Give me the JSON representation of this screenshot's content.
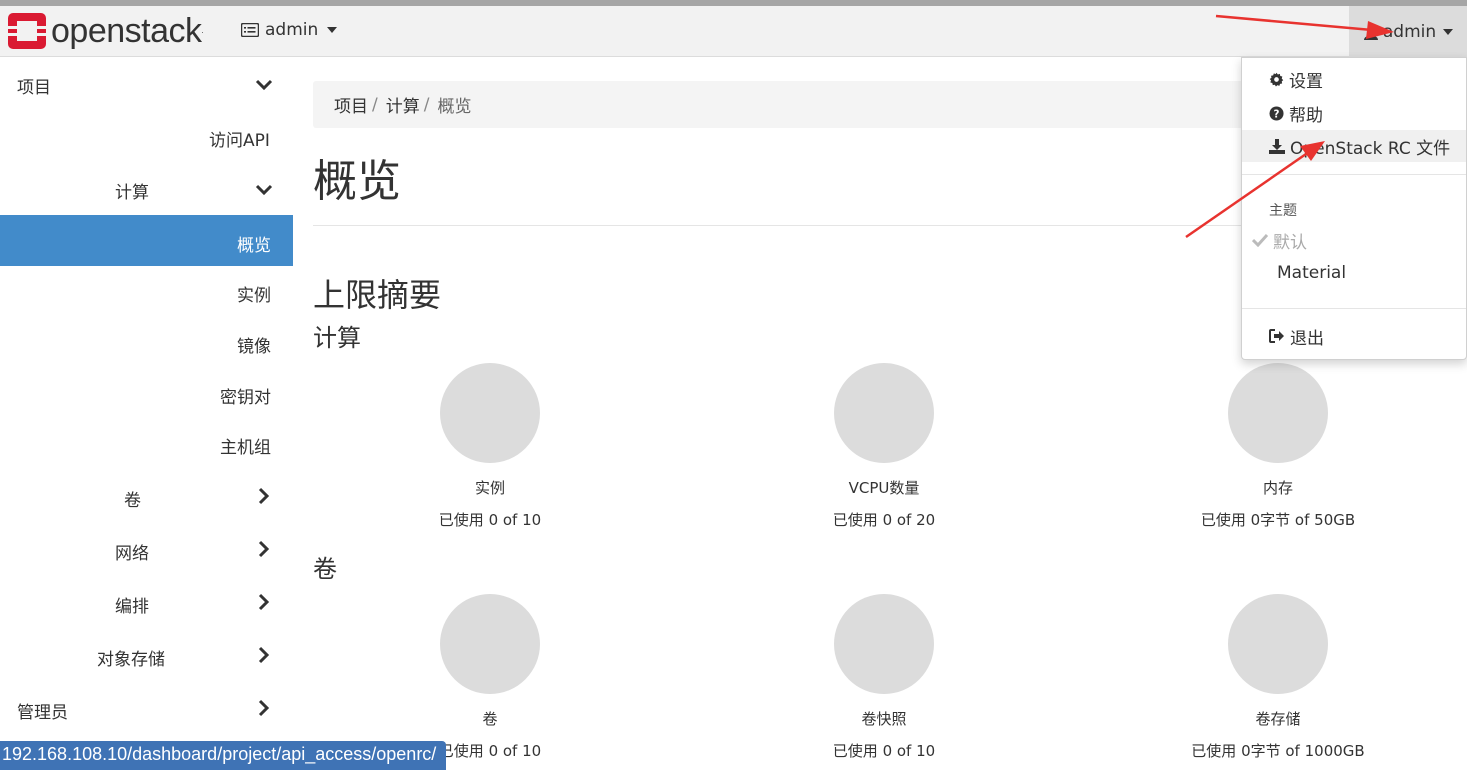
{
  "brand": {
    "name": "openstack",
    "tm": "."
  },
  "navbar": {
    "project_label": "admin",
    "user_label": "admin"
  },
  "sidebar": {
    "project": "项目",
    "api_access": "访问API",
    "compute": "计算",
    "overview": "概览",
    "instances": "实例",
    "images": "镜像",
    "keypairs": "密钥对",
    "host_groups": "主机组",
    "volumes": "卷",
    "network": "网络",
    "orchestration": "编排",
    "object_store": "对象存储",
    "admin": "管理员"
  },
  "breadcrumb": {
    "items": [
      "项目",
      "计算",
      "概览"
    ],
    "sep": "/"
  },
  "page": {
    "title": "概览",
    "limit_summary": "上限摘要",
    "compute_heading": "计算",
    "volume_heading": "卷"
  },
  "compute_limits": [
    {
      "label": "实例",
      "usage": "已使用 0 of 10",
      "used_fraction": 0
    },
    {
      "label": "VCPU数量",
      "usage": "已使用 0 of 20",
      "used_fraction": 0
    },
    {
      "label": "内存",
      "usage": "已使用 0字节 of 50GB",
      "used_fraction": 0
    }
  ],
  "volume_limits": [
    {
      "label": "卷",
      "usage": "已使用 0 of 10",
      "used_fraction": 0
    },
    {
      "label": "卷快照",
      "usage": "已使用 0 of 10",
      "used_fraction": 0
    },
    {
      "label": "卷存储",
      "usage": "已使用 0字节 of 1000GB",
      "used_fraction": 0
    }
  ],
  "user_menu": {
    "settings": "设置",
    "help": "帮助",
    "rc_file": "OpenStack RC 文件",
    "theme_header": "主题",
    "theme_default": "默认",
    "theme_material": "Material",
    "logout": "退出"
  },
  "status_url": "192.168.108.10/dashboard/project/api_access/openrc/",
  "colors": {
    "accent": "#428bca",
    "annotation": "#e8332f",
    "logo_red": "#da1a32"
  }
}
